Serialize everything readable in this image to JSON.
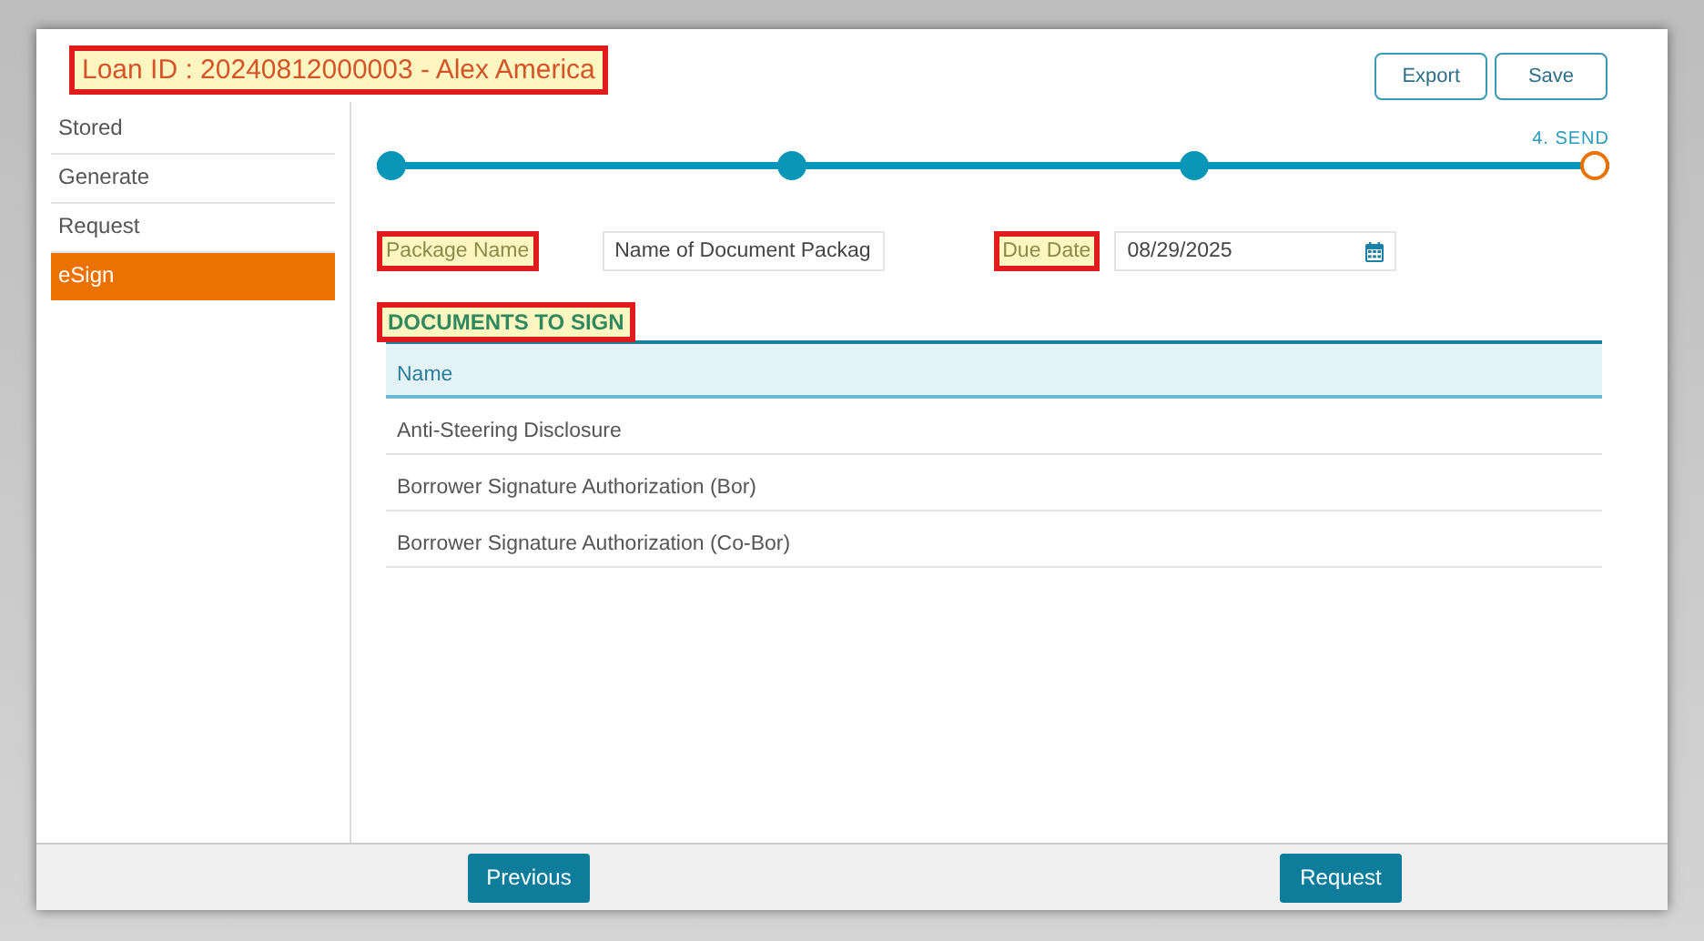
{
  "header": {
    "title": "Loan ID : 20240812000003  - Alex America",
    "buttons": [
      "Export",
      "Save"
    ]
  },
  "sidebar": {
    "items": [
      {
        "label": "Stored",
        "selected": false
      },
      {
        "label": "Generate",
        "selected": false
      },
      {
        "label": "Request",
        "selected": false
      },
      {
        "label": "eSign",
        "selected": true
      }
    ]
  },
  "stepper": {
    "steps": [
      {
        "completed": true
      },
      {
        "completed": true
      },
      {
        "completed": true
      },
      {
        "completed": false,
        "label": "4. SEND"
      }
    ]
  },
  "form": {
    "package_name": {
      "label": "Package Name",
      "value": "Name of Document Packag"
    },
    "due_date": {
      "label": "Due Date",
      "value": "08/29/2025"
    }
  },
  "documents": {
    "title": "DOCUMENTS TO SIGN",
    "columns": [
      "Name"
    ],
    "rows": [
      [
        "Anti-Steering Disclosure"
      ],
      [
        "Borrower Signature Authorization (Bor)"
      ],
      [
        "Borrower Signature Authorization (Co-Bor)"
      ]
    ]
  },
  "footer": {
    "buttons": [
      "Previous",
      "Request"
    ]
  }
}
